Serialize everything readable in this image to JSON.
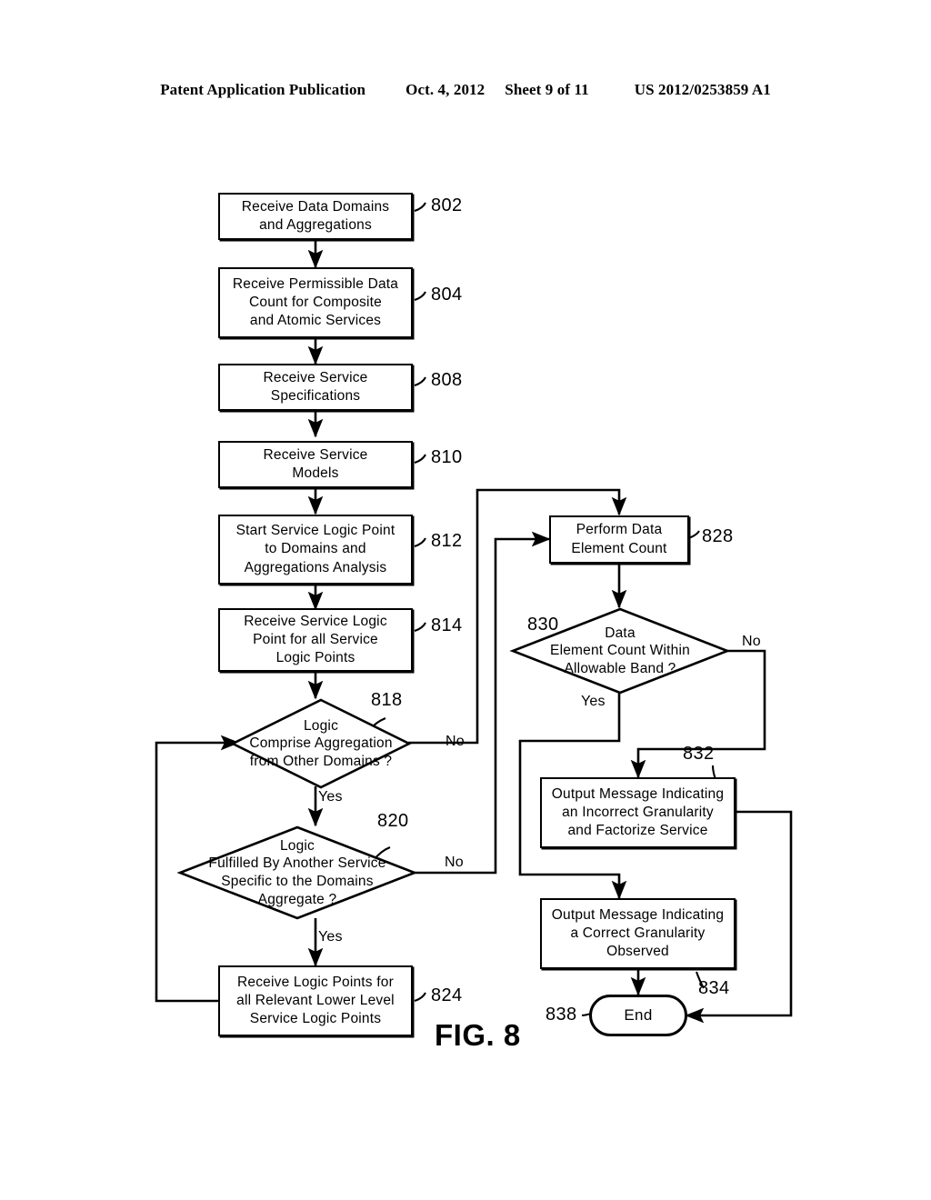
{
  "header": {
    "publication": "Patent Application Publication",
    "date": "Oct. 4, 2012",
    "sheet": "Sheet 9 of 11",
    "number": "US 2012/0253859 A1"
  },
  "figure": {
    "caption": "FIG. 8",
    "nodes": [
      {
        "id": "802",
        "type": "process",
        "text": "Receive Data Domains\nand Aggregations"
      },
      {
        "id": "804",
        "type": "process",
        "text": "Receive Permissible Data\nCount for Composite\nand Atomic Services"
      },
      {
        "id": "808",
        "type": "process",
        "text": "Receive Service\nSpecifications"
      },
      {
        "id": "810",
        "type": "process",
        "text": "Receive Service\nModels"
      },
      {
        "id": "812",
        "type": "process",
        "text": "Start Service Logic Point\nto Domains and\nAggregations Analysis"
      },
      {
        "id": "814",
        "type": "process",
        "text": "Receive Service Logic\nPoint for all Service\nLogic Points"
      },
      {
        "id": "818",
        "type": "decision",
        "text": "Logic\nComprise Aggregation\nfrom Other Domains ?"
      },
      {
        "id": "820",
        "type": "decision",
        "text": "Logic\nFulfilled By Another Service\nSpecific to the Domains\nAggregate ?"
      },
      {
        "id": "824",
        "type": "process",
        "text": "Receive Logic Points for\nall Relevant Lower Level\nService Logic Points"
      },
      {
        "id": "828",
        "type": "process",
        "text": "Perform Data\nElement Count"
      },
      {
        "id": "830",
        "type": "decision",
        "text": "Data\nElement Count Within\nAllowable Band ?"
      },
      {
        "id": "832",
        "type": "process",
        "text": "Output Message Indicating\nan Incorrect Granularity\nand Factorize Service"
      },
      {
        "id": "834",
        "type": "process",
        "text": "Output Message Indicating\na Correct Granularity\nObserved"
      },
      {
        "id": "838",
        "type": "terminator",
        "text": "End"
      }
    ],
    "edge_labels": {
      "d818_no": "No",
      "d818_yes": "Yes",
      "d820_no": "No",
      "d820_yes": "Yes",
      "d830_no": "No",
      "d830_yes": "Yes"
    }
  },
  "colors": {
    "ink": "#000000",
    "paper": "#ffffff"
  }
}
